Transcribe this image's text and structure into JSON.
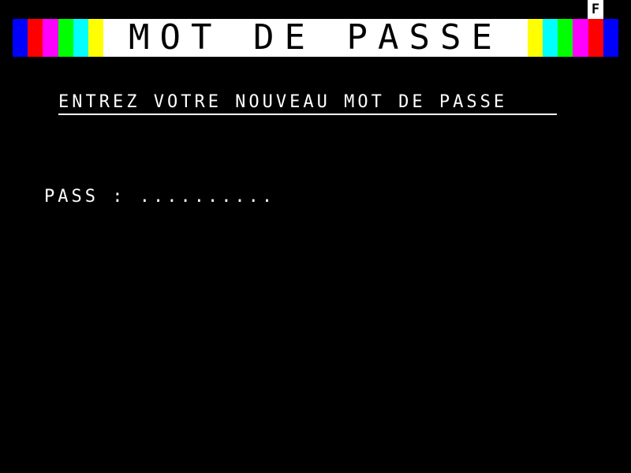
{
  "header": {
    "title": "MOT DE PASSE",
    "status_indicator": "F",
    "stripes_left": [
      "#0000ff",
      "#ff0000",
      "#ff00ff",
      "#00ff00",
      "#00ffff",
      "#ffff00"
    ],
    "stripes_right": [
      "#ffff00",
      "#00ffff",
      "#00ff00",
      "#ff00ff",
      "#ff0000",
      "#0000ff"
    ]
  },
  "main": {
    "instruction": "ENTREZ VOTRE NOUVEAU MOT DE PASSE",
    "pass_label": "PASS : ",
    "pass_value": ".........."
  },
  "colors": {
    "background": "#000000",
    "foreground": "#ffffff"
  }
}
